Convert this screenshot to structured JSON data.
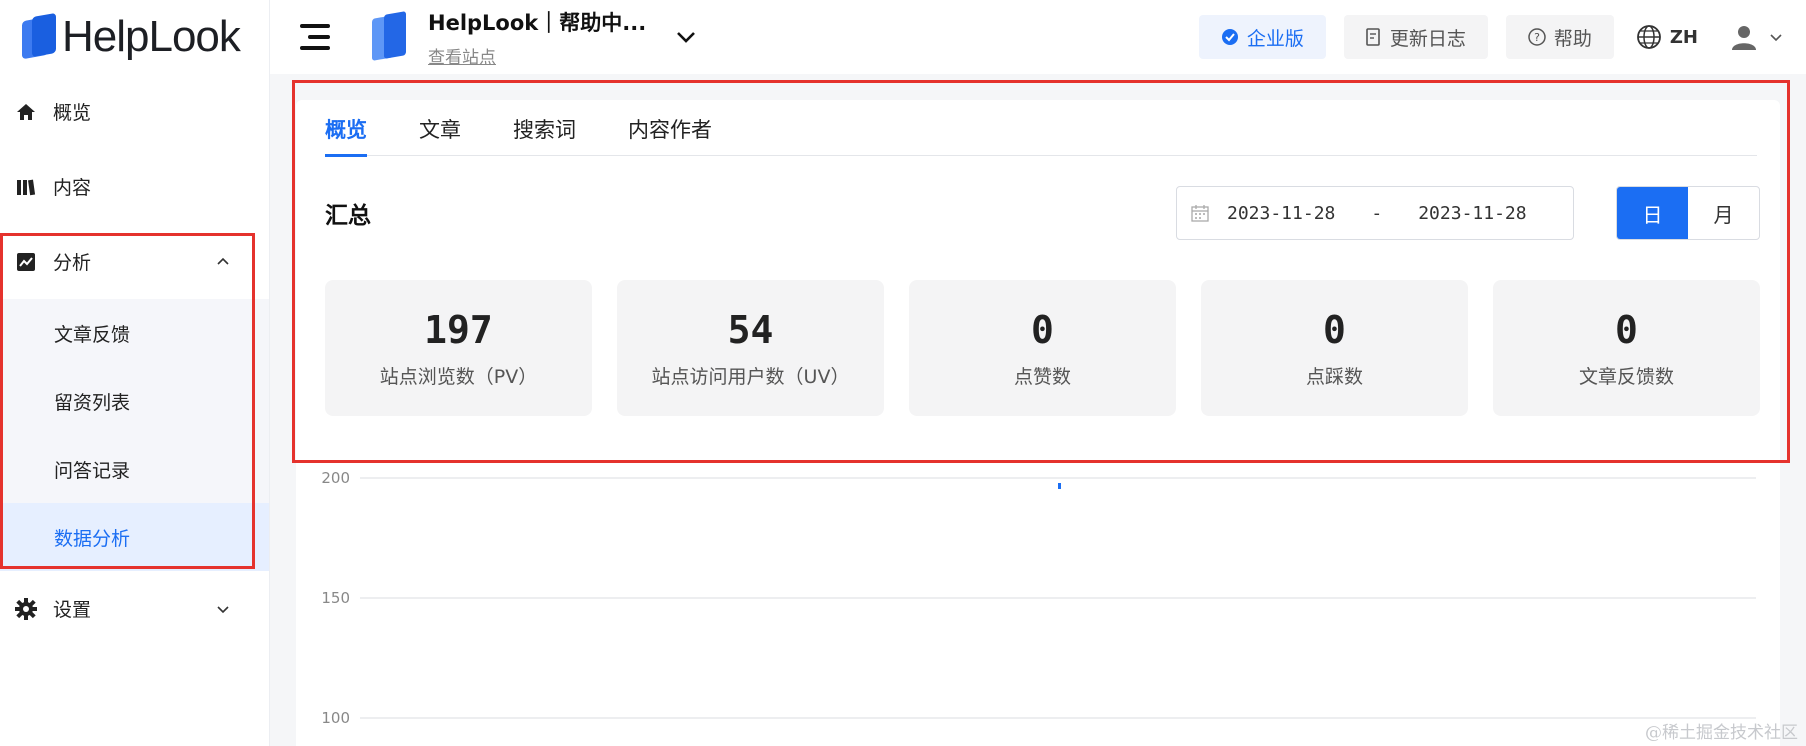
{
  "brand": {
    "name": "HelpLook"
  },
  "sidebar": {
    "items": [
      {
        "label": "概览",
        "icon": "home-icon"
      },
      {
        "label": "内容",
        "icon": "books-icon"
      },
      {
        "label": "分析",
        "icon": "trend-icon",
        "expanded": true
      },
      {
        "label": "设置",
        "icon": "gear-icon",
        "expanded": false
      }
    ],
    "analysis_children": [
      {
        "label": "文章反馈",
        "active": false
      },
      {
        "label": "留资列表",
        "active": false
      },
      {
        "label": "问答记录",
        "active": false
      },
      {
        "label": "数据分析",
        "active": true
      }
    ]
  },
  "header": {
    "site_name": "HelpLook｜帮助中...",
    "site_link": "查看站点",
    "enterprise_label": "企业版",
    "changelog_label": "更新日志",
    "help_label": "帮助",
    "language": "ZH"
  },
  "tabs": [
    {
      "label": "概览",
      "active": true
    },
    {
      "label": "文章",
      "active": false
    },
    {
      "label": "搜索词",
      "active": false
    },
    {
      "label": "内容作者",
      "active": false
    }
  ],
  "summary": {
    "title": "汇总",
    "date_start": "2023-11-28",
    "date_separator": "-",
    "date_end": "2023-11-28",
    "granularity": [
      {
        "label": "日",
        "selected": true
      },
      {
        "label": "月",
        "selected": false
      }
    ],
    "cards": [
      {
        "value": "197",
        "label": "站点浏览数（PV）"
      },
      {
        "value": "54",
        "label": "站点访问用户数（UV）"
      },
      {
        "value": "0",
        "label": "点赞数"
      },
      {
        "value": "0",
        "label": "点踩数"
      },
      {
        "value": "0",
        "label": "文章反馈数"
      }
    ]
  },
  "chart": {
    "y_ticks": [
      "200",
      "150",
      "100"
    ]
  },
  "watermark": "@稀土掘金技术社区",
  "colors": {
    "accent": "#1b6ef3",
    "highlight_border": "#e5322d"
  }
}
